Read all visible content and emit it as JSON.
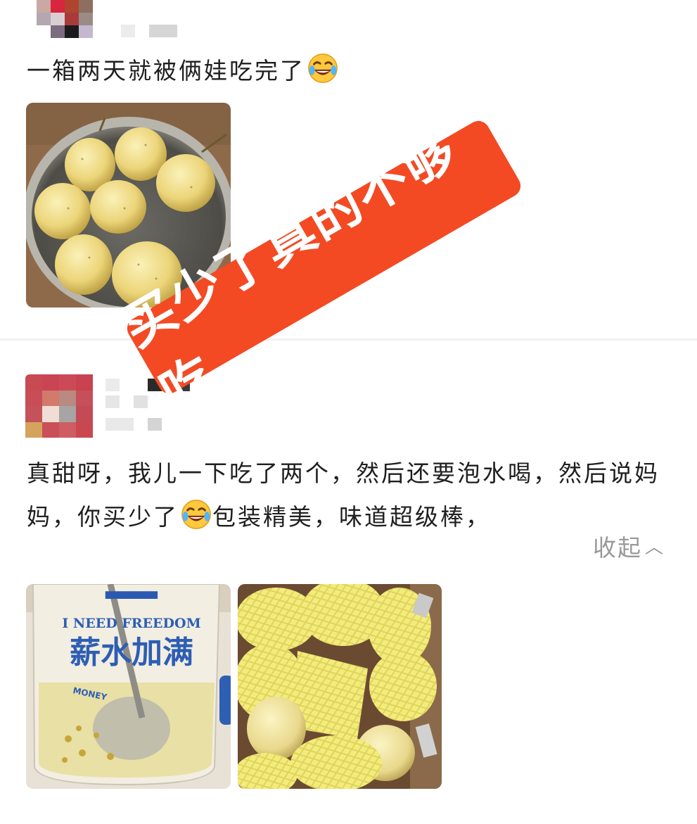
{
  "reviews": [
    {
      "text": "一箱两天就被俩娃吃完了",
      "emoji": "laughing-tears-emoji",
      "photos": [
        {
          "subject": "plate-of-passion-fruits"
        }
      ]
    },
    {
      "text_part1": "真甜呀，我儿一下吃了两个，然后还要泡水喝，然后说妈妈，你买少了",
      "emoji": "laughing-tears-emoji",
      "text_part2": "包装精美，味道超级棒，",
      "collapse_label": "收起",
      "photos": [
        {
          "subject": "glass-cup-with-passion-fruit-drink",
          "cup_text_en": "I NEED FREEDOM",
          "cup_text_cn": "薪水加满",
          "cup_text_small": "MONEY"
        },
        {
          "subject": "box-of-passion-fruits-in-foam-nets"
        }
      ]
    }
  ],
  "banner": {
    "text": "买少了真的不够吃",
    "color": "#f34a24"
  },
  "colors": {
    "text": "#1f1f1f",
    "muted": "#999999",
    "divider": "#f2f2f2"
  }
}
